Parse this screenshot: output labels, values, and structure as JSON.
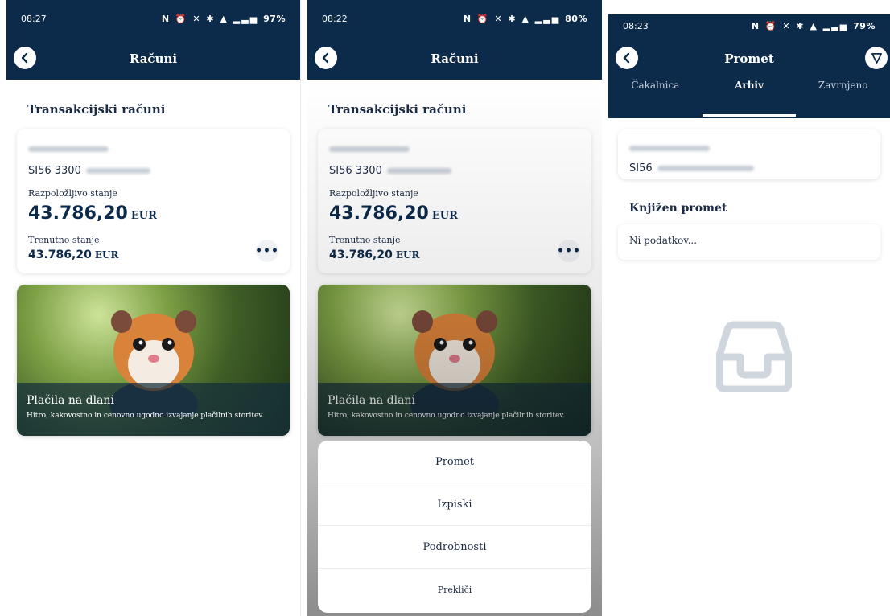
{
  "colors": {
    "navy": "#0c2a4a",
    "white": "#ffffff",
    "text": "#1b2a44",
    "icon_gray": "#cfd6de"
  },
  "screen1": {
    "status": {
      "time": "08:27",
      "battery": "97%",
      "icons": "N ⏰ ✕ ✱ ▲ ▂▃▅"
    },
    "header": {
      "title": "Računi"
    },
    "section_title": "Transakcijski računi",
    "account": {
      "iban_prefix": "SI56 3300",
      "available_label": "Razpoložljivo stanje",
      "available_amount": "43.786,20",
      "currency": "EUR",
      "current_label": "Trenutno stanje",
      "current_amount": "43.786,20"
    },
    "promo": {
      "title": "Plačila na dlani",
      "subtitle": "Hitro, kakovostno in cenovno ugodno izvajanje plačilnih storitev."
    }
  },
  "screen2": {
    "status": {
      "time": "08:22",
      "battery": "80%",
      "icons": "N ⏰ ✕ ✱ ▲ ▂▃▅"
    },
    "header": {
      "title": "Računi"
    },
    "section_title": "Transakcijski računi",
    "account": {
      "iban_prefix": "SI56 3300",
      "available_label": "Razpoložljivo stanje",
      "available_amount": "43.786,20",
      "currency": "EUR",
      "current_label": "Trenutno stanje",
      "current_amount": "43.786,20"
    },
    "promo": {
      "title": "Plačila na dlani",
      "subtitle": "Hitro, kakovostno in cenovno ugodno izvajanje plačilnih storitev."
    },
    "sheet": {
      "items": [
        "Promet",
        "Izpiski",
        "Podrobnosti"
      ],
      "cancel": "Prekliči"
    }
  },
  "screen3": {
    "status": {
      "time": "08:23",
      "battery": "79%",
      "icons": "N ⏰ ✕ ✱ ▲ ▂▃▅"
    },
    "header": {
      "title": "Promet"
    },
    "tabs": [
      "Čakalnica",
      "Arhiv",
      "Zavrnjeno"
    ],
    "active_tab": "Arhiv",
    "account": {
      "iban_prefix": "SI56"
    },
    "section_title": "Knjižen promet",
    "empty_text": "Ni podatkov..."
  }
}
